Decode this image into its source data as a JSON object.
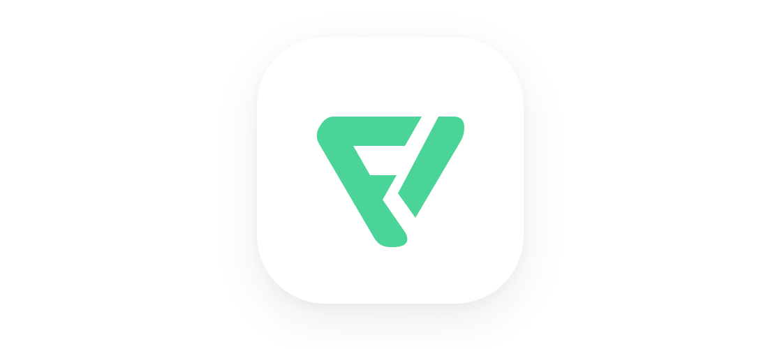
{
  "app_icon": {
    "icon": "fv-logo-icon",
    "accent_color": "#4BD498",
    "tile_color": "#ffffff"
  }
}
